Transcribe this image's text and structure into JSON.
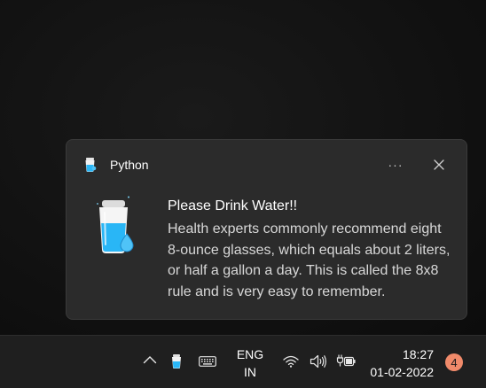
{
  "notification": {
    "app_name": "Python",
    "title": "Please Drink Water!!",
    "body": "Health experts commonly recommend eight 8-ounce glasses, which equals about 2 liters, or half a gallon a day. This is called the 8x8 rule and is very easy to remember.",
    "more_label": "···",
    "icons": {
      "app": "water-glass-icon",
      "more": "more-options-icon",
      "close": "close-icon"
    }
  },
  "taskbar": {
    "language_line1": "ENG",
    "language_line2": "IN",
    "time": "18:27",
    "date": "01-02-2022",
    "notification_count": "4",
    "icons": [
      "chevron-up-icon",
      "python-tray-icon",
      "keyboard-icon",
      "wifi-icon",
      "volume-icon",
      "battery-icon"
    ]
  },
  "colors": {
    "toast_background": "#2b2b2b",
    "taskbar_background": "#1f1f1f",
    "badge": "#f08a6a",
    "water": "#29b6f6"
  }
}
